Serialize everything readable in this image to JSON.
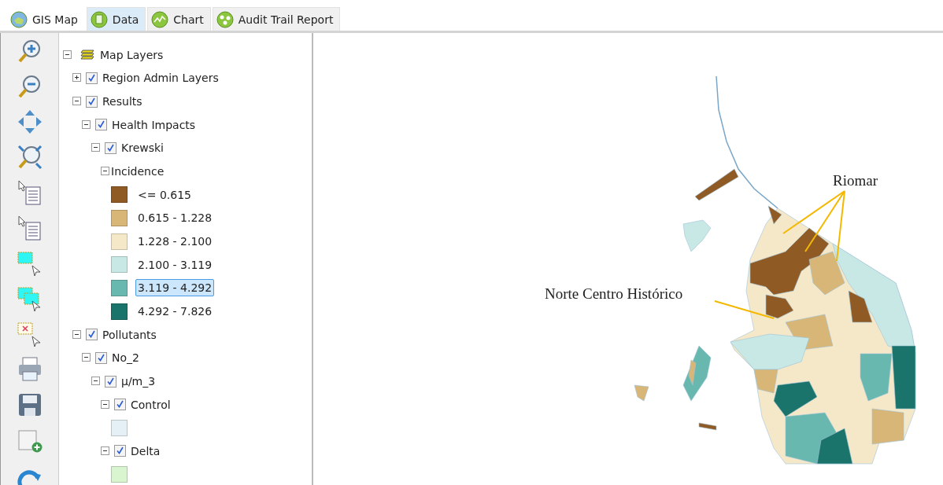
{
  "tabs": [
    {
      "label": "GIS Map",
      "selected": true,
      "hovered": false
    },
    {
      "label": "Data",
      "selected": false,
      "hovered": true
    },
    {
      "label": "Chart",
      "selected": false,
      "hovered": false
    },
    {
      "label": "Audit Trail Report",
      "selected": false,
      "hovered": false
    }
  ],
  "layers": {
    "label": "Map Layers",
    "expanded": true,
    "children": [
      {
        "kind": "layer",
        "label": "Region Admin Layers",
        "checked": true,
        "expanded": false
      },
      {
        "kind": "layer",
        "label": "Results",
        "checked": true,
        "expanded": true,
        "children": [
          {
            "kind": "layer",
            "label": "Health Impacts",
            "checked": true,
            "expanded": true,
            "children": [
              {
                "kind": "layer",
                "label": "Krewski",
                "checked": true,
                "expanded": true,
                "children": [
                  {
                    "kind": "group",
                    "label": "Incidence",
                    "expanded": true,
                    "children": [
                      {
                        "kind": "legend",
                        "label": "<= 0.615",
                        "color": "#8f5a24",
                        "selected": false
                      },
                      {
                        "kind": "legend",
                        "label": "0.615 - 1.228",
                        "color": "#d8b677",
                        "selected": false
                      },
                      {
                        "kind": "legend",
                        "label": "1.228 - 2.100",
                        "color": "#f4e8c9",
                        "selected": false
                      },
                      {
                        "kind": "legend",
                        "label": "2.100 - 3.119",
                        "color": "#c7e8e4",
                        "selected": false
                      },
                      {
                        "kind": "legend",
                        "label": "3.119 - 4.292",
                        "color": "#68b8b0",
                        "selected": true
                      },
                      {
                        "kind": "legend",
                        "label": "4.292 - 7.826",
                        "color": "#1a746b",
                        "selected": false
                      }
                    ]
                  }
                ]
              }
            ]
          }
        ]
      },
      {
        "kind": "layer",
        "label": "Pollutants",
        "checked": true,
        "expanded": true,
        "children": [
          {
            "kind": "layer",
            "label": "No_2",
            "checked": true,
            "expanded": true,
            "children": [
              {
                "kind": "layer",
                "label": "μ/m_3",
                "checked": true,
                "expanded": true,
                "children": [
                  {
                    "kind": "layer",
                    "label": "Control",
                    "checked": true,
                    "expanded": true,
                    "children": [
                      {
                        "kind": "legend",
                        "color": "#e4eff6"
                      }
                    ]
                  },
                  {
                    "kind": "layer",
                    "label": "Delta",
                    "checked": true,
                    "expanded": true,
                    "children": [
                      {
                        "kind": "legend",
                        "color": "#d8f5cf"
                      }
                    ]
                  }
                ]
              }
            ]
          }
        ]
      }
    ]
  },
  "map_labels": [
    {
      "label": "Riomar"
    },
    {
      "label": "Norte Centro Histórico"
    }
  ]
}
